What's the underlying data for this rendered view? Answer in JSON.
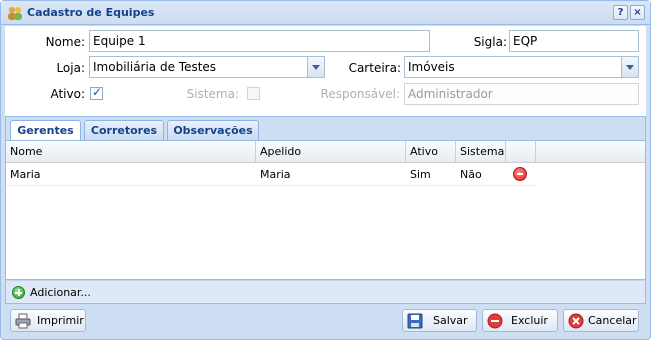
{
  "window": {
    "title": "Cadastro de Equipes",
    "help_label": "?",
    "close_label": "×"
  },
  "form": {
    "nome_label": "Nome:",
    "nome_value": "Equipe 1",
    "sigla_label": "Sigla:",
    "sigla_value": "EQP",
    "loja_label": "Loja:",
    "loja_value": "Imobiliária de Testes",
    "carteira_label": "Carteira:",
    "carteira_value": "Imóveis",
    "ativo_label": "Ativo:",
    "ativo_checked": true,
    "sistema_label": "Sistema:",
    "sistema_checked": false,
    "responsavel_label": "Responsável:",
    "responsavel_value": "Administrador"
  },
  "tabs": [
    {
      "label": "Gerentes",
      "active": true
    },
    {
      "label": "Corretores",
      "active": false
    },
    {
      "label": "Observações",
      "active": false
    }
  ],
  "grid": {
    "columns": [
      "Nome",
      "Apelido",
      "Ativo",
      "Sistema"
    ],
    "rows": [
      {
        "nome": "Maria",
        "apelido": "Maria",
        "ativo": "Sim",
        "sistema": "Não"
      }
    ]
  },
  "grid_toolbar": {
    "add_label": "Adicionar..."
  },
  "footer": {
    "print_label": "Imprimir",
    "save_label": "Salvar",
    "delete_label": "Excluir",
    "cancel_label": "Cancelar"
  },
  "colors": {
    "accent": "#15428b",
    "border": "#99bbe8",
    "panel": "#cfdff3"
  }
}
